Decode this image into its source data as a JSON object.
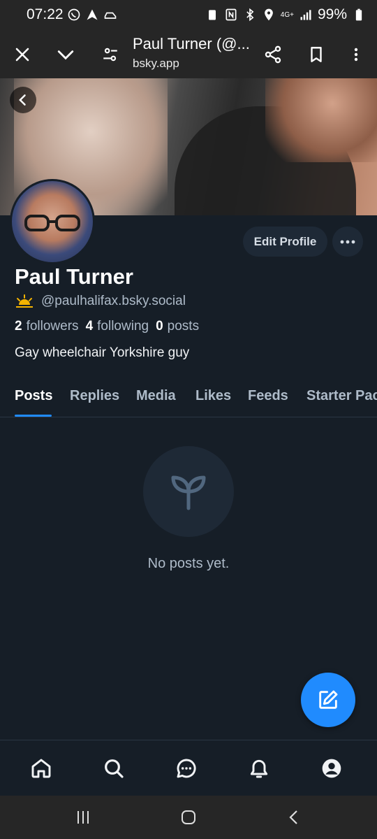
{
  "status_bar": {
    "time": "07:22",
    "battery": "99%",
    "network": "4G+"
  },
  "browser": {
    "title": "Paul Turner (@...",
    "url": "bsky.app"
  },
  "profile": {
    "display_name": "Paul Turner",
    "handle": "@paulhalifax.bsky.social",
    "followers_count": "2",
    "followers_label": "followers",
    "following_count": "4",
    "following_label": "following",
    "posts_count": "0",
    "posts_label": "posts",
    "bio": "Gay wheelchair Yorkshire guy",
    "edit_label": "Edit Profile",
    "more_label": "···"
  },
  "tabs": [
    {
      "label": "Posts",
      "active": true
    },
    {
      "label": "Replies"
    },
    {
      "label": "Media"
    },
    {
      "label": "Likes"
    },
    {
      "label": "Feeds"
    },
    {
      "label": "Starter Pac"
    }
  ],
  "empty_state": {
    "text": "No posts yet.",
    "icon": "seedling-icon"
  },
  "colors": {
    "background": "#161e27",
    "accent": "#208bfe",
    "muted": "#aebbc9",
    "surface": "#1e2936"
  },
  "bottom_nav": [
    "home-icon",
    "search-icon",
    "chat-icon",
    "bell-icon",
    "profile-icon"
  ]
}
